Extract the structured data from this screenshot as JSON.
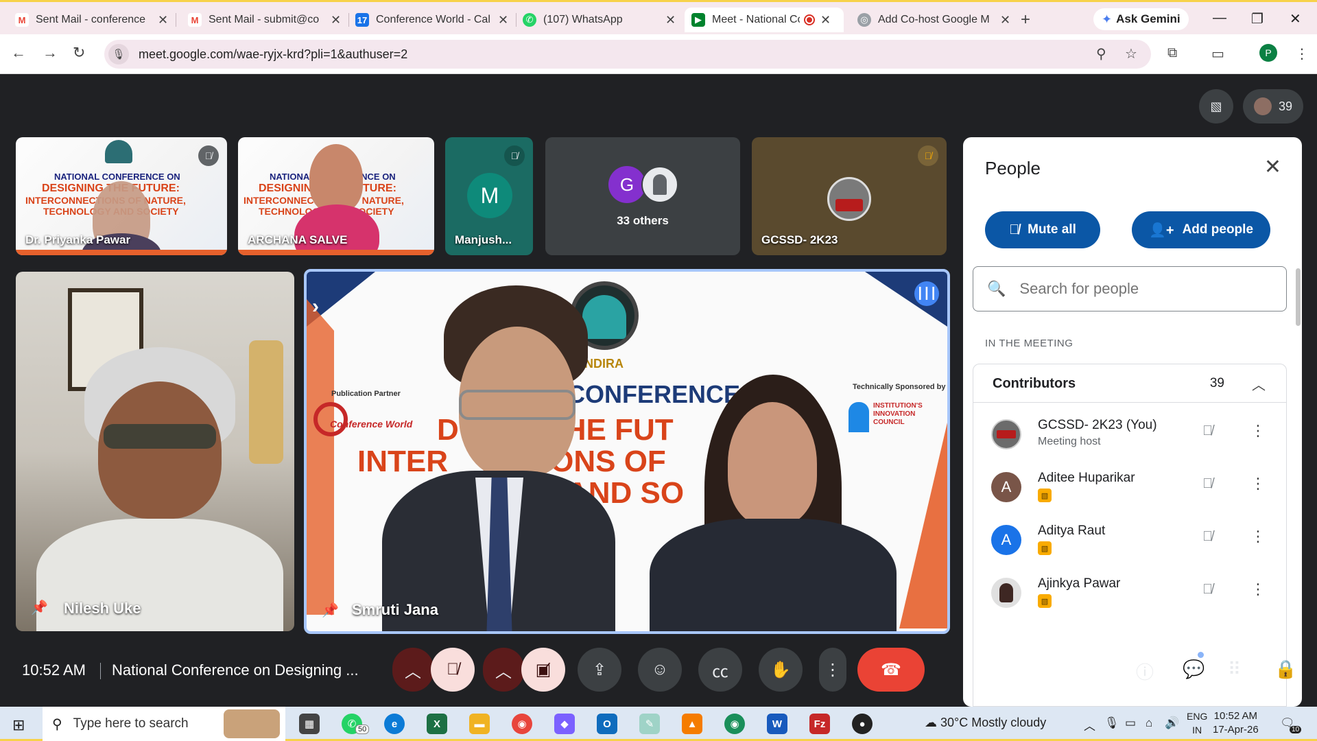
{
  "browser": {
    "tabs": [
      {
        "title": "Sent Mail - conference",
        "icon": "gmail-icon"
      },
      {
        "title": "Sent Mail - submit@co",
        "icon": "gmail-icon"
      },
      {
        "title": "Conference World - Cal",
        "icon": "calendar-icon"
      },
      {
        "title": "(107) WhatsApp",
        "icon": "whatsapp-icon"
      },
      {
        "title": "Meet - National Co",
        "icon": "meet-icon"
      },
      {
        "title": "Add Co-host Google M",
        "icon": "globe-icon"
      }
    ],
    "ask_gemini": "Ask Gemini",
    "url": "meet.google.com/wae-ryjx-krd?pli=1&authuser=2",
    "profile_initial": "P"
  },
  "meet": {
    "participant_count": "39",
    "tiles": {
      "t1_name": "Dr. Priyanka Pawar",
      "t2_name": "ARCHANA SALVE",
      "t3_name": "Manjush...",
      "t3_initial": "M",
      "t4_label": "33 others",
      "t4_initial": "G",
      "t5_name": "GCSSD- 2K23",
      "big1_name": "Nilesh Uke",
      "big2_name": "Smruti Jana"
    },
    "banner": {
      "logo_text": "INDIRA",
      "headline": "CONFERENCE O",
      "line2": "D    NG THE FUT",
      "line3": "INTER    ECTIONS OF",
      "line4": "       GY AND SO",
      "publication": "Publication Partner",
      "sponsor": "Technically Sponsored by",
      "sponsor_name": "INSTITUTION'S INNOVATION COUNCIL",
      "partner_logo": "Conference World"
    },
    "small_banner": {
      "line1": "NATIONAL CONFERENCE ON",
      "line2": "DESIGNING THE FUTURE:",
      "line3": "INTERCONNECTIONS OF NATURE,",
      "line4": "TECHNOLOGY AND SOCIETY"
    },
    "people": {
      "title": "People",
      "mute_all": "Mute all",
      "add_people": "Add people",
      "search_placeholder": "Search for people",
      "section": "IN THE MEETING",
      "group_title": "Contributors",
      "group_count": "39",
      "list": [
        {
          "name": "GCSSD- 2K23 (You)",
          "sub": "Meeting host",
          "initial": "",
          "color": "#6b6b6b"
        },
        {
          "name": "Aditee Huparikar",
          "sub": "",
          "initial": "A",
          "color": "#795548"
        },
        {
          "name": "Aditya Raut",
          "sub": "",
          "initial": "A",
          "color": "#1a73e8"
        },
        {
          "name": "Ajinkya Pawar",
          "sub": "",
          "initial": "",
          "color": "#e0e0e0"
        }
      ]
    },
    "bottom": {
      "time": "10:52 AM",
      "title": "National Conference on Designing ..."
    }
  },
  "taskbar": {
    "search": "Type here to search",
    "whatsapp_badge": "50",
    "weather": "30°C  Mostly cloudy",
    "lang1": "ENG",
    "lang2": "IN",
    "time": "10:52 AM",
    "date": "17-Apr-26",
    "notif": "10"
  },
  "colors": {
    "meet_bg": "#202124",
    "end_call": "#ea4335",
    "mute_red": "#f9dedc",
    "accent_blue": "#0b57a6"
  }
}
